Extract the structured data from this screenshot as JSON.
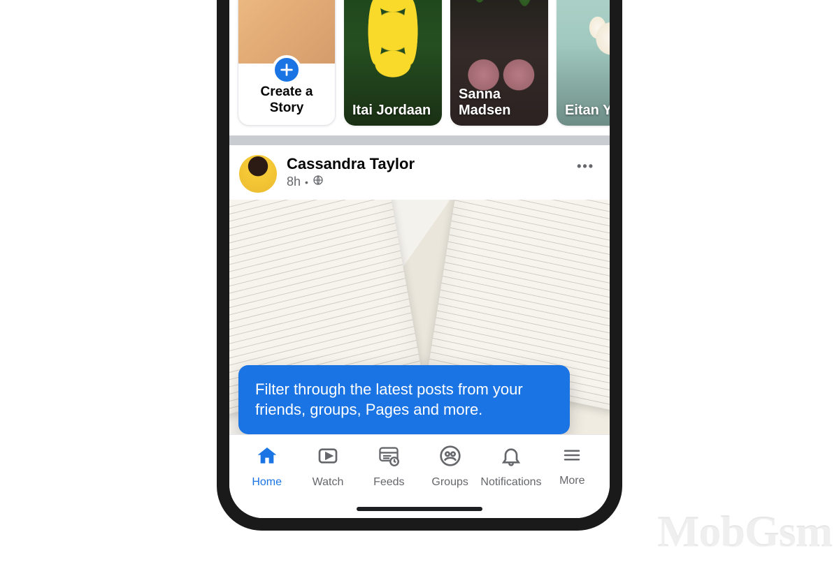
{
  "watermark": "MobGsm",
  "stories": {
    "create": {
      "label": "Create a Story"
    },
    "items": [
      {
        "name": "Itai Jordaan"
      },
      {
        "name": "Sanna Madsen"
      },
      {
        "name": "Eitan Yama"
      }
    ]
  },
  "post": {
    "author": "Cassandra Taylor",
    "time": "8h",
    "privacy": "public"
  },
  "tooltip": {
    "text": "Filter through the latest posts from your friends, groups, Pages and more."
  },
  "nav": {
    "items": [
      {
        "label": "Home",
        "active": true
      },
      {
        "label": "Watch"
      },
      {
        "label": "Feeds"
      },
      {
        "label": "Groups"
      },
      {
        "label": "Notifications"
      },
      {
        "label": "More"
      }
    ]
  }
}
